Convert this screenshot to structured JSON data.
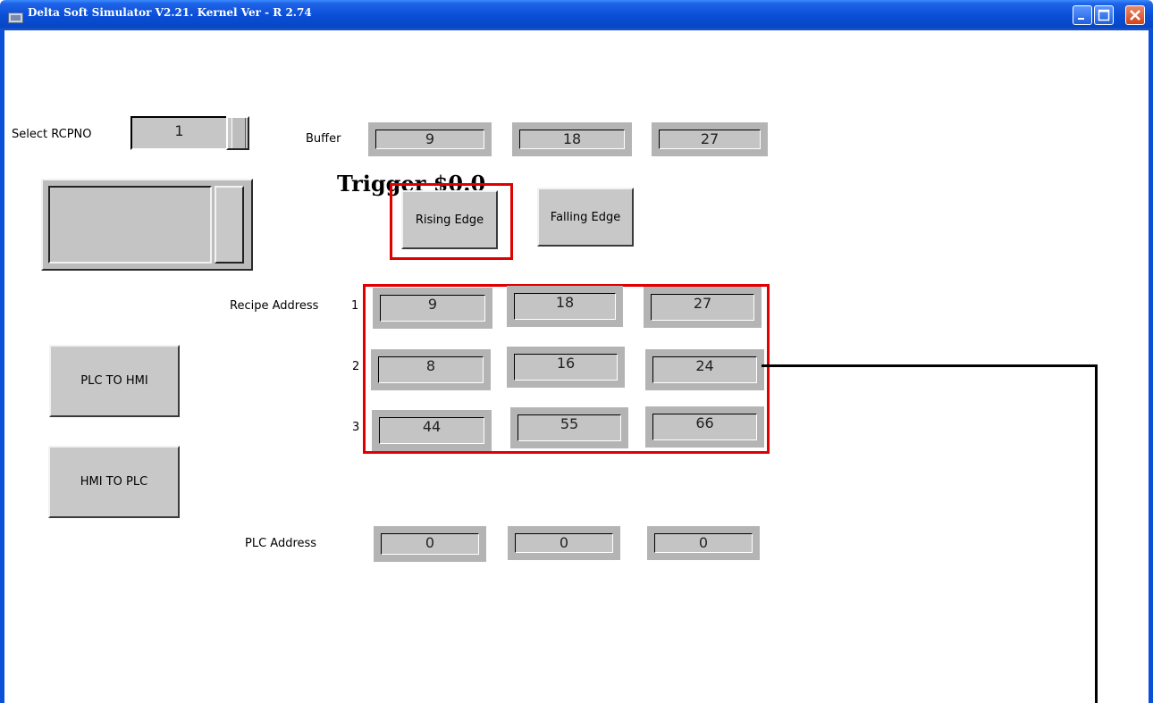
{
  "window": {
    "title": "Delta Soft Simulator V2.21. Kernel Ver - R 2.74",
    "icons": [
      "app-icon",
      "minimize-icon",
      "maximize-icon",
      "close-icon"
    ]
  },
  "recipe_selector": {
    "label": "Select RCPNO",
    "value": "1"
  },
  "buffer": {
    "label": "Buffer",
    "values": [
      "9",
      "18",
      "27"
    ]
  },
  "trigger": {
    "title": "Trigger $0.0",
    "rising_label": "Rising Edge",
    "falling_label": "Falling Edge"
  },
  "recipe_address": {
    "label": "Recipe Address",
    "row_numbers": [
      "1",
      "2",
      "3"
    ],
    "rows": [
      [
        "9",
        "18",
        "27"
      ],
      [
        "8",
        "16",
        "24"
      ],
      [
        "44",
        "55",
        "66"
      ]
    ]
  },
  "actions": {
    "plc_to_hmi": "PLC TO HMI",
    "hmi_to_plc": "HMI TO PLC"
  },
  "plc_address": {
    "label": "PLC Address",
    "values": [
      "0",
      "0",
      "0"
    ]
  },
  "colors": {
    "title_bar": "#0a4fd8",
    "highlight": "#e00000",
    "panel_gray": "#b4b4b4"
  }
}
